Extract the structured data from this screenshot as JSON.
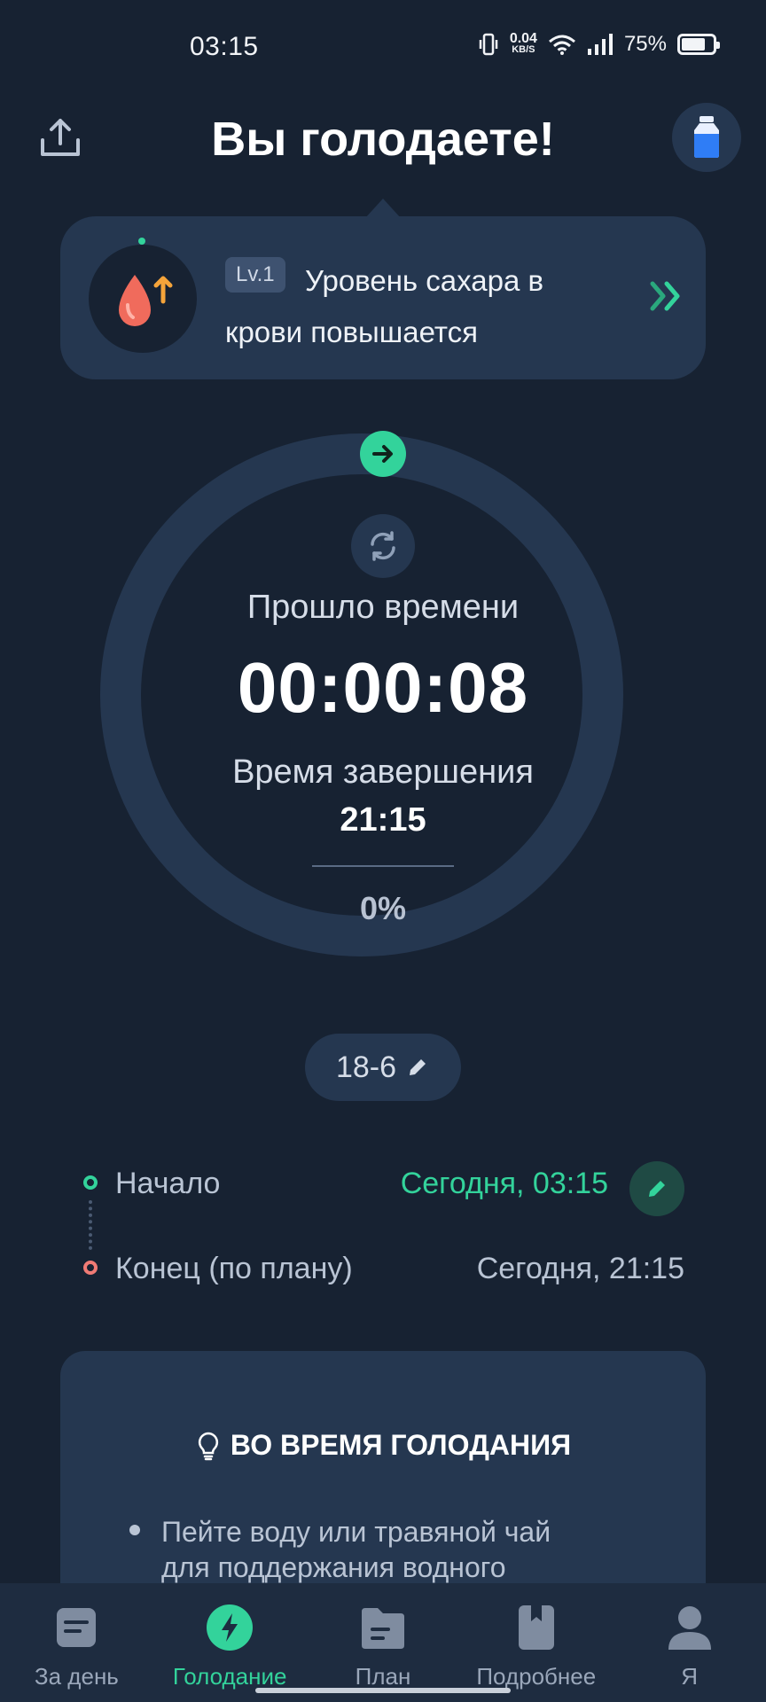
{
  "status_bar": {
    "time": "03:15",
    "net_speed_value": "0.04",
    "net_speed_unit": "KB/S",
    "battery_percent": "75%",
    "battery_level": 0.75
  },
  "header": {
    "title": "Вы голодаете!"
  },
  "stage": {
    "level": "Lv.1",
    "text": "Уровень сахара в крови повышается"
  },
  "timer": {
    "elapsed_label": "Прошло времени",
    "elapsed_value": "00:00:08",
    "end_label": "Время завершения",
    "end_value": "21:15",
    "percent": "0%",
    "progress": 0
  },
  "plan": {
    "label": "18-6"
  },
  "times": {
    "start_label": "Начало",
    "start_value": "Сегодня, 03:15",
    "end_label": "Конец (по плану)",
    "end_value": "Сегодня, 21:15"
  },
  "tips": {
    "title": "ВО ВРЕМЯ ГОЛОДАНИЯ",
    "item_1": "Пейте воду или травяной чай для поддержания водного"
  },
  "nav": {
    "day": "За день",
    "fasting": "Голодание",
    "plan": "План",
    "more": "Подробнее",
    "me": "Я"
  },
  "colors": {
    "background": "#172232",
    "card": "#253750",
    "accent": "#33d39b",
    "end_marker": "#f07b75"
  }
}
